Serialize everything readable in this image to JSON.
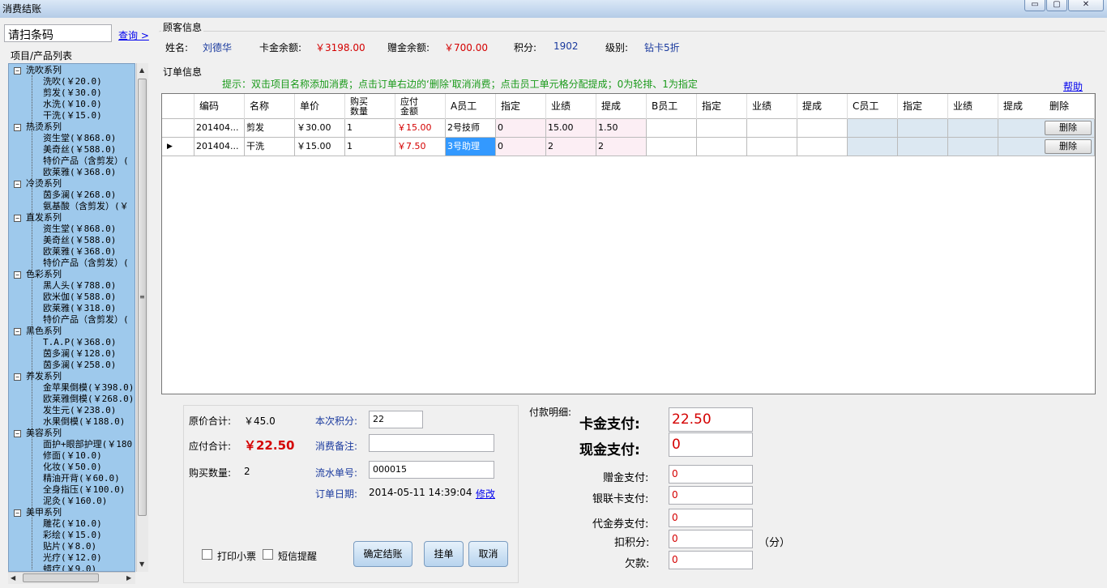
{
  "window": {
    "title": "消费结账",
    "minimize": "▭",
    "maximize": "▢",
    "close": "✕"
  },
  "left": {
    "barcode_value": "请扫条码",
    "query_link": "查询 >",
    "list_header": "项目/产品列表",
    "tree": [
      {
        "type": "cat",
        "label": "洗吹系列"
      },
      {
        "type": "item",
        "label": "洗吹(￥20.0)"
      },
      {
        "type": "item",
        "label": "剪发(￥30.0)"
      },
      {
        "type": "item",
        "label": "水洗(￥10.0)"
      },
      {
        "type": "item",
        "label": "干洗(￥15.0)"
      },
      {
        "type": "cat",
        "label": "热烫系列"
      },
      {
        "type": "item",
        "label": "资生堂(￥868.0)"
      },
      {
        "type": "item",
        "label": "美奇丝(￥588.0)"
      },
      {
        "type": "item",
        "label": "特价产品（含剪发）("
      },
      {
        "type": "item",
        "label": "欧莱雅(￥368.0)"
      },
      {
        "type": "cat",
        "label": "冷烫系列"
      },
      {
        "type": "item",
        "label": "茵多澜(￥268.0)"
      },
      {
        "type": "item",
        "label": "氨基酸（含剪发）(￥"
      },
      {
        "type": "cat",
        "label": "直发系列"
      },
      {
        "type": "item",
        "label": "资生堂(￥868.0)"
      },
      {
        "type": "item",
        "label": "美奇丝(￥588.0)"
      },
      {
        "type": "item",
        "label": "欧莱雅(￥368.0)"
      },
      {
        "type": "item",
        "label": "特价产品（含剪发）("
      },
      {
        "type": "cat",
        "label": "色彩系列"
      },
      {
        "type": "item",
        "label": "黑人头(￥788.0)"
      },
      {
        "type": "item",
        "label": "欧米伽(￥588.0)"
      },
      {
        "type": "item",
        "label": "欧莱雅(￥318.0)"
      },
      {
        "type": "item",
        "label": "特价产品（含剪发）("
      },
      {
        "type": "cat",
        "label": "黑色系列"
      },
      {
        "type": "item",
        "label": "T.A.P(￥368.0)"
      },
      {
        "type": "item",
        "label": "茵多澜(￥128.0)"
      },
      {
        "type": "item",
        "label": "茵多澜(￥258.0)"
      },
      {
        "type": "cat",
        "label": "养发系列"
      },
      {
        "type": "item",
        "label": "金苹果倒模(￥398.0)"
      },
      {
        "type": "item",
        "label": "欧莱雅倒模(￥268.0)"
      },
      {
        "type": "item",
        "label": "发生元(￥238.0)"
      },
      {
        "type": "item",
        "label": "水果倒模(￥188.0)"
      },
      {
        "type": "cat",
        "label": "美容系列"
      },
      {
        "type": "item",
        "label": "面护+眼部护理(￥180"
      },
      {
        "type": "item",
        "label": "修面(￥10.0)"
      },
      {
        "type": "item",
        "label": "化妆(￥50.0)"
      },
      {
        "type": "item",
        "label": "精油开背(￥60.0)"
      },
      {
        "type": "item",
        "label": "全身指压(￥100.0)"
      },
      {
        "type": "item",
        "label": "泥灸(￥160.0)"
      },
      {
        "type": "cat",
        "label": "美甲系列"
      },
      {
        "type": "item",
        "label": "雕花(￥10.0)"
      },
      {
        "type": "item",
        "label": "彩绘(￥15.0)"
      },
      {
        "type": "item",
        "label": "贴片(￥8.0)"
      },
      {
        "type": "item",
        "label": "光疗(￥12.0)"
      },
      {
        "type": "item",
        "label": "蜡疗(￥9.0)"
      }
    ]
  },
  "customer": {
    "group_title": "顾客信息",
    "name_label": "姓名:",
    "name": "刘德华",
    "card_label": "卡金余额:",
    "card": "￥3198.00",
    "gift_label": "赠金余额:",
    "gift": "￥700.00",
    "points_label": "积分:",
    "points": "1902",
    "level_label": "级别:",
    "level": "钻卡5折"
  },
  "order": {
    "group_title": "订单信息",
    "tip": "提示：双击项目名称添加消费；点击订单右边的‘删除’取消消费；点击员工单元格分配提成；0为轮排、1为指定",
    "help": "帮助",
    "headers": [
      "编码",
      "名称",
      "单价",
      "购买\n数量",
      "应付\n金额",
      "A员工",
      "指定",
      "业绩",
      "提成",
      "B员工",
      "指定",
      "业绩",
      "提成",
      "C员工",
      "指定",
      "业绩",
      "提成",
      "删除"
    ],
    "rows": [
      {
        "code": "201404...",
        "name": "剪发",
        "price": "￥30.00",
        "qty": "1",
        "due": "￥15.00",
        "a_staff": "2号技师",
        "a_assign": "0",
        "a_perf": "15.00",
        "a_comm": "1.50",
        "delete": "删除"
      },
      {
        "code": "201404...",
        "name": "干洗",
        "price": "￥15.00",
        "qty": "1",
        "due": "￥7.50",
        "a_staff": "3号助理",
        "a_assign": "0",
        "a_perf": "2",
        "a_comm": "2",
        "delete": "删除"
      }
    ]
  },
  "summary": {
    "orig_label": "原价合计:",
    "orig": "￥45.0",
    "due_label": "应付合计:",
    "due": "￥22.50",
    "qty_label": "购买数量:",
    "qty": "2",
    "points_label": "本次积分:",
    "points": "22",
    "note_label": "消费备注:",
    "note": "",
    "serial_label": "流水单号:",
    "serial": "000015",
    "date_label": "订单日期:",
    "date": "2014-05-11 14:39:04",
    "modify": "修改",
    "print_label": "打印小票",
    "sms_label": "短信提醒",
    "confirm": "确定结账",
    "hang": "挂单",
    "cancel": "取消"
  },
  "payment": {
    "title": "付款明细:",
    "card_label": "卡金支付:",
    "card": "22.50",
    "cash_label": "现金支付:",
    "cash": "0",
    "gift_label": "赠金支付:",
    "gift": "0",
    "union_label": "银联卡支付:",
    "union": "0",
    "voucher_label": "代金券支付:",
    "voucher": "0",
    "points_label": "扣积分:",
    "points": "0",
    "points_unit": "（分）",
    "debt_label": "欠款:",
    "debt": "0"
  }
}
